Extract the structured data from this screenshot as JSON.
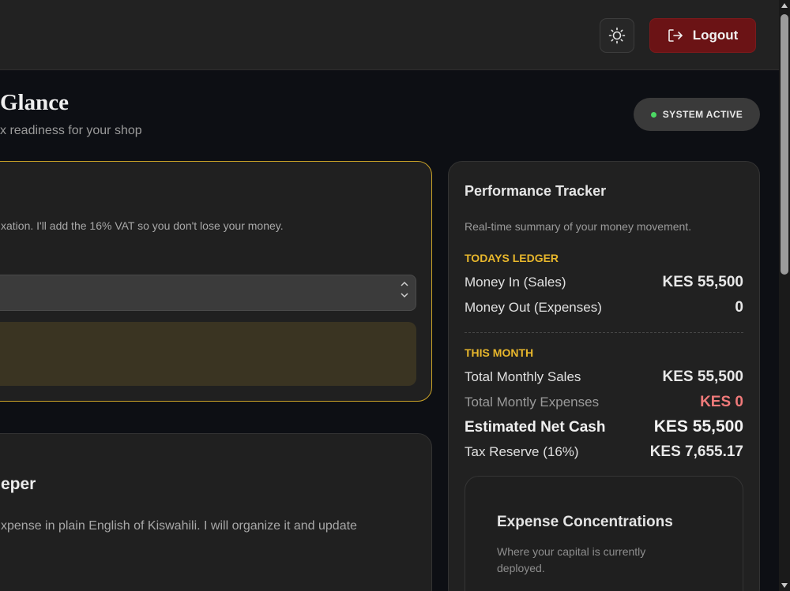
{
  "header": {
    "theme_icon": "sun-icon",
    "logout_icon": "logout-arrow-icon",
    "logout_label": "Logout",
    "logout_color": "#6b1315"
  },
  "page": {
    "title": "Glance",
    "subtitle": "x readiness for your shop",
    "status": "SYSTEM ACTIVE",
    "status_color": "#4cd964"
  },
  "vat_card": {
    "description": "xation. I'll add the 16% VAT so you don't lose your money.",
    "border_color": "#c9a227"
  },
  "keeper_card": {
    "title": "eper",
    "description": "xpense in plain English of Kiswahili. I will organize it and update"
  },
  "performance": {
    "title": "Performance Tracker",
    "subtitle": "Real-time summary of your money movement.",
    "today": {
      "label": "TODAYS LEDGER",
      "money_in_label": "Money In (Sales)",
      "money_in_value": "KES 55,500",
      "money_out_label": "Money Out (Expenses)",
      "money_out_value": "0"
    },
    "month": {
      "label": "THIS MONTH",
      "sales_label": "Total Monthly Sales",
      "sales_value": "KES 55,500",
      "expenses_label": "Total Montly Expenses",
      "expenses_value": "KES 0",
      "net_label": "Estimated Net Cash",
      "net_value": "KES 55,500",
      "tax_label": "Tax Reserve (16%)",
      "tax_value": "KES 7,655.17"
    },
    "accent_color": "#e8b72c",
    "negative_color": "#f07a7a"
  },
  "expense": {
    "title": "Expense Concentrations",
    "subtitle": "Where your capital is currently deployed."
  }
}
